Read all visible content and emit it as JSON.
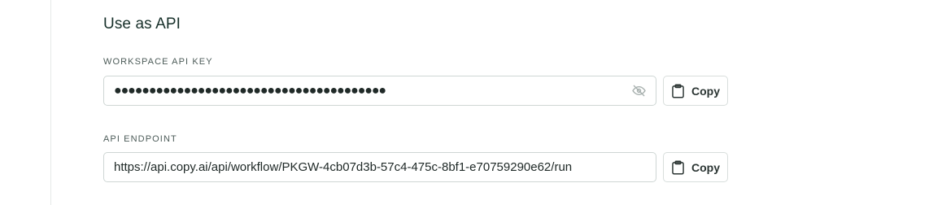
{
  "section": {
    "title": "Use as API"
  },
  "api_key": {
    "label": "WORKSPACE API KEY",
    "masked_value": "●●●●●●●●●●●●●●●●●●●●●●●●●●●●●●●●●●●●●●●",
    "visibility_icon": "eye-off-icon",
    "copy_label": "Copy",
    "copy_icon": "clipboard-icon"
  },
  "endpoint": {
    "label": "API ENDPOINT",
    "value": "https://api.copy.ai/api/workflow/PKGW-4cb07d3b-57c4-475c-8bf1-e70759290e62/run",
    "copy_label": "Copy",
    "copy_icon": "clipboard-icon"
  }
}
